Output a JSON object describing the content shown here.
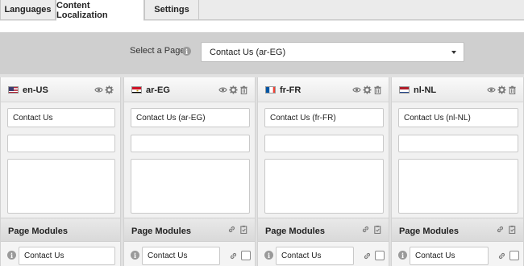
{
  "tabs": [
    {
      "label": "Languages"
    },
    {
      "label": "Content Localization"
    },
    {
      "label": "Settings"
    }
  ],
  "page_select": {
    "label": "Select a Page:",
    "value": "Contact Us (ar-EG)"
  },
  "columns": [
    {
      "lang": "en-US",
      "flag": "us",
      "title": "Contact Us",
      "url": "",
      "description": "",
      "modules_label": "Page Modules",
      "module_title": "Contact Us"
    },
    {
      "lang": "ar-EG",
      "flag": "eg",
      "title": "Contact Us (ar-EG)",
      "url": "",
      "description": "",
      "modules_label": "Page Modules",
      "module_title": "Contact Us"
    },
    {
      "lang": "fr-FR",
      "flag": "fr",
      "title": "Contact Us (fr-FR)",
      "url": "",
      "description": "",
      "modules_label": "Page Modules",
      "module_title": "Contact Us"
    },
    {
      "lang": "nl-NL",
      "flag": "nl",
      "title": "Contact Us (nl-NL)",
      "url": "",
      "description": "",
      "modules_label": "Page Modules",
      "module_title": "Contact Us"
    }
  ],
  "icons": {
    "view": "eye-icon",
    "settings": "gear-icon",
    "delete": "trash-icon",
    "link": "link-icon",
    "copy": "clipboard-icon",
    "info": "info-icon"
  },
  "colors": {
    "select_bar": "#cfcfcf",
    "icon_gray": "#7a7a7a"
  }
}
